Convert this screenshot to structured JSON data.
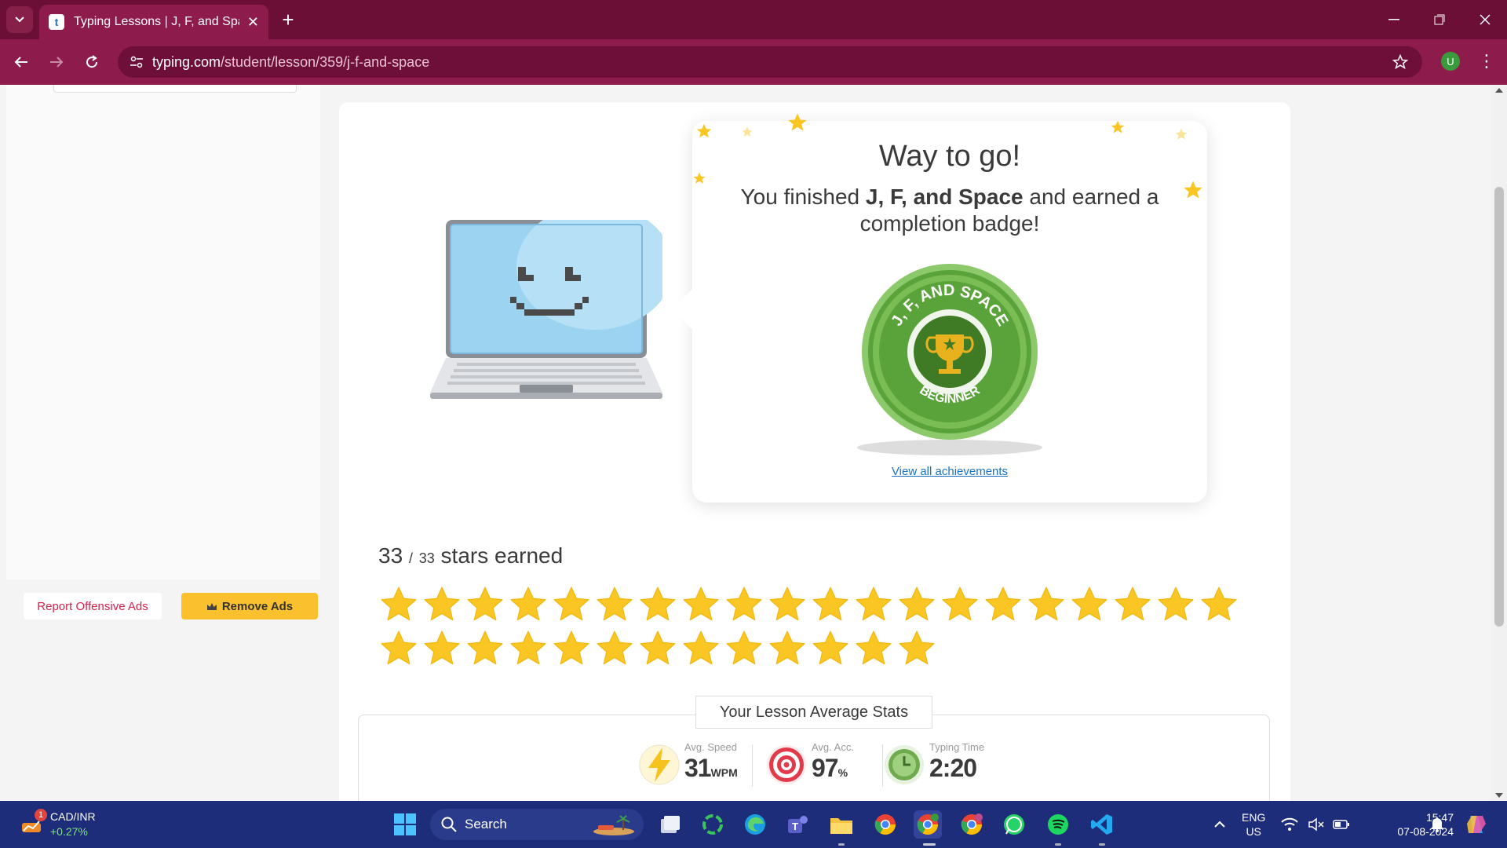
{
  "browser": {
    "tab_title": "Typing Lessons | J, F, and Space",
    "url_host": "typing.com",
    "url_path": "/student/lesson/359/j-f-and-space",
    "profile_initial": "U"
  },
  "sidebar": {
    "report_label": "Report Offensive Ads",
    "remove_ads_label": "Remove Ads"
  },
  "result": {
    "title": "Way to go!",
    "message_prefix": "You finished ",
    "lesson_name": "J, F, and Space",
    "message_suffix": " and earned a completion badge!",
    "badge_top_text": "J, F, AND SPACE",
    "badge_bottom_text": "BEGINNER",
    "achievements_link": "View all achievements"
  },
  "stars": {
    "earned": 33,
    "total": 33,
    "earned_text": "33",
    "total_text": "33",
    "label": "stars earned",
    "color": "#f9c623"
  },
  "stats": {
    "title": "Your Lesson Average Stats",
    "speed_label": "Avg. Speed",
    "speed_value": "31",
    "speed_unit": "WPM",
    "accuracy_label": "Avg. Acc.",
    "accuracy_value": "97",
    "accuracy_unit": "%",
    "time_label": "Typing Time",
    "time_value": "2:20"
  },
  "taskbar": {
    "ticker_name": "CAD/INR",
    "ticker_change": "+0.27%",
    "ticker_badge": "1",
    "search_label": "Search",
    "lang_line1": "ENG",
    "lang_line2": "US",
    "time": "15:47",
    "date": "07-08-2024"
  },
  "colors": {
    "chrome": "#8d1b4c",
    "accent_yellow": "#fbc02d",
    "link_blue": "#1a73c9",
    "badge_green": "#5aa33a"
  }
}
